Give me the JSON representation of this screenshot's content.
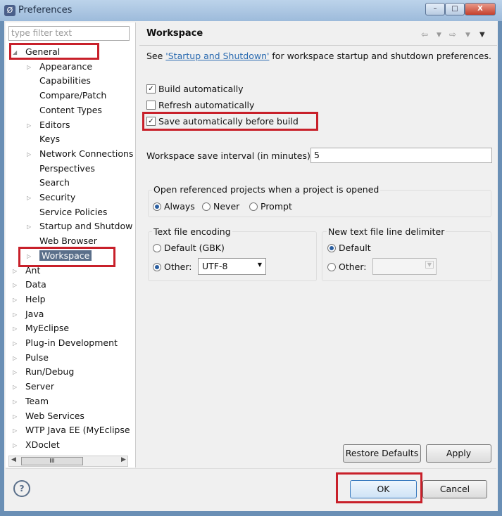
{
  "window": {
    "title": "Preferences",
    "min": "–",
    "max": "□",
    "close": "X"
  },
  "filter": {
    "placeholder": "type filter text"
  },
  "tree": {
    "items": [
      {
        "label": "General",
        "level": 0,
        "expand": "open"
      },
      {
        "label": "Appearance",
        "level": 1,
        "expand": "closed"
      },
      {
        "label": "Capabilities",
        "level": 1,
        "expand": "none"
      },
      {
        "label": "Compare/Patch",
        "level": 1,
        "expand": "none"
      },
      {
        "label": "Content Types",
        "level": 1,
        "expand": "none"
      },
      {
        "label": "Editors",
        "level": 1,
        "expand": "closed"
      },
      {
        "label": "Keys",
        "level": 1,
        "expand": "none"
      },
      {
        "label": "Network Connections",
        "level": 1,
        "expand": "closed"
      },
      {
        "label": "Perspectives",
        "level": 1,
        "expand": "none"
      },
      {
        "label": "Search",
        "level": 1,
        "expand": "none"
      },
      {
        "label": "Security",
        "level": 1,
        "expand": "closed"
      },
      {
        "label": "Service Policies",
        "level": 1,
        "expand": "none"
      },
      {
        "label": "Startup and Shutdow",
        "level": 1,
        "expand": "closed"
      },
      {
        "label": "Web Browser",
        "level": 1,
        "expand": "none"
      },
      {
        "label": "Workspace",
        "level": 1,
        "expand": "closed",
        "selected": true
      },
      {
        "label": "Ant",
        "level": 0,
        "expand": "closed"
      },
      {
        "label": "Data",
        "level": 0,
        "expand": "closed"
      },
      {
        "label": "Help",
        "level": 0,
        "expand": "closed"
      },
      {
        "label": "Java",
        "level": 0,
        "expand": "closed"
      },
      {
        "label": "MyEclipse",
        "level": 0,
        "expand": "closed"
      },
      {
        "label": "Plug-in Development",
        "level": 0,
        "expand": "closed"
      },
      {
        "label": "Pulse",
        "level": 0,
        "expand": "closed"
      },
      {
        "label": "Run/Debug",
        "level": 0,
        "expand": "closed"
      },
      {
        "label": "Server",
        "level": 0,
        "expand": "closed"
      },
      {
        "label": "Team",
        "level": 0,
        "expand": "closed"
      },
      {
        "label": "Web Services",
        "level": 0,
        "expand": "closed"
      },
      {
        "label": "WTP Java EE (MyEclipse",
        "level": 0,
        "expand": "closed"
      },
      {
        "label": "XDoclet",
        "level": 0,
        "expand": "closed"
      }
    ],
    "scroll_thumb": "III"
  },
  "page": {
    "title": "Workspace",
    "desc_pre": "See ",
    "desc_link": "'Startup and Shutdown'",
    "desc_post": " for workspace startup and shutdown preferences.",
    "build_auto": {
      "label": "Build automatically",
      "checked": true
    },
    "refresh_auto": {
      "label": "Refresh automatically",
      "checked": false
    },
    "save_auto": {
      "label": "Save automatically before build",
      "checked": true
    },
    "interval_label": "Workspace save interval (in minutes):",
    "interval_value": "5",
    "open_ref": {
      "title": "Open referenced projects when a project is opened",
      "options": [
        "Always",
        "Never",
        "Prompt"
      ],
      "selected": "Always"
    },
    "encoding": {
      "title": "Text file encoding",
      "default": "Default (GBK)",
      "other": "Other:",
      "value": "UTF-8",
      "selected": "Other"
    },
    "delimiter": {
      "title": "New text file line delimiter",
      "default": "Default",
      "other": "Other:",
      "value": "",
      "selected": "Default"
    },
    "restore": "Restore Defaults",
    "apply": "Apply"
  },
  "footer": {
    "help": "?",
    "ok": "OK",
    "cancel": "Cancel"
  },
  "highlight_color": "#c8202a"
}
